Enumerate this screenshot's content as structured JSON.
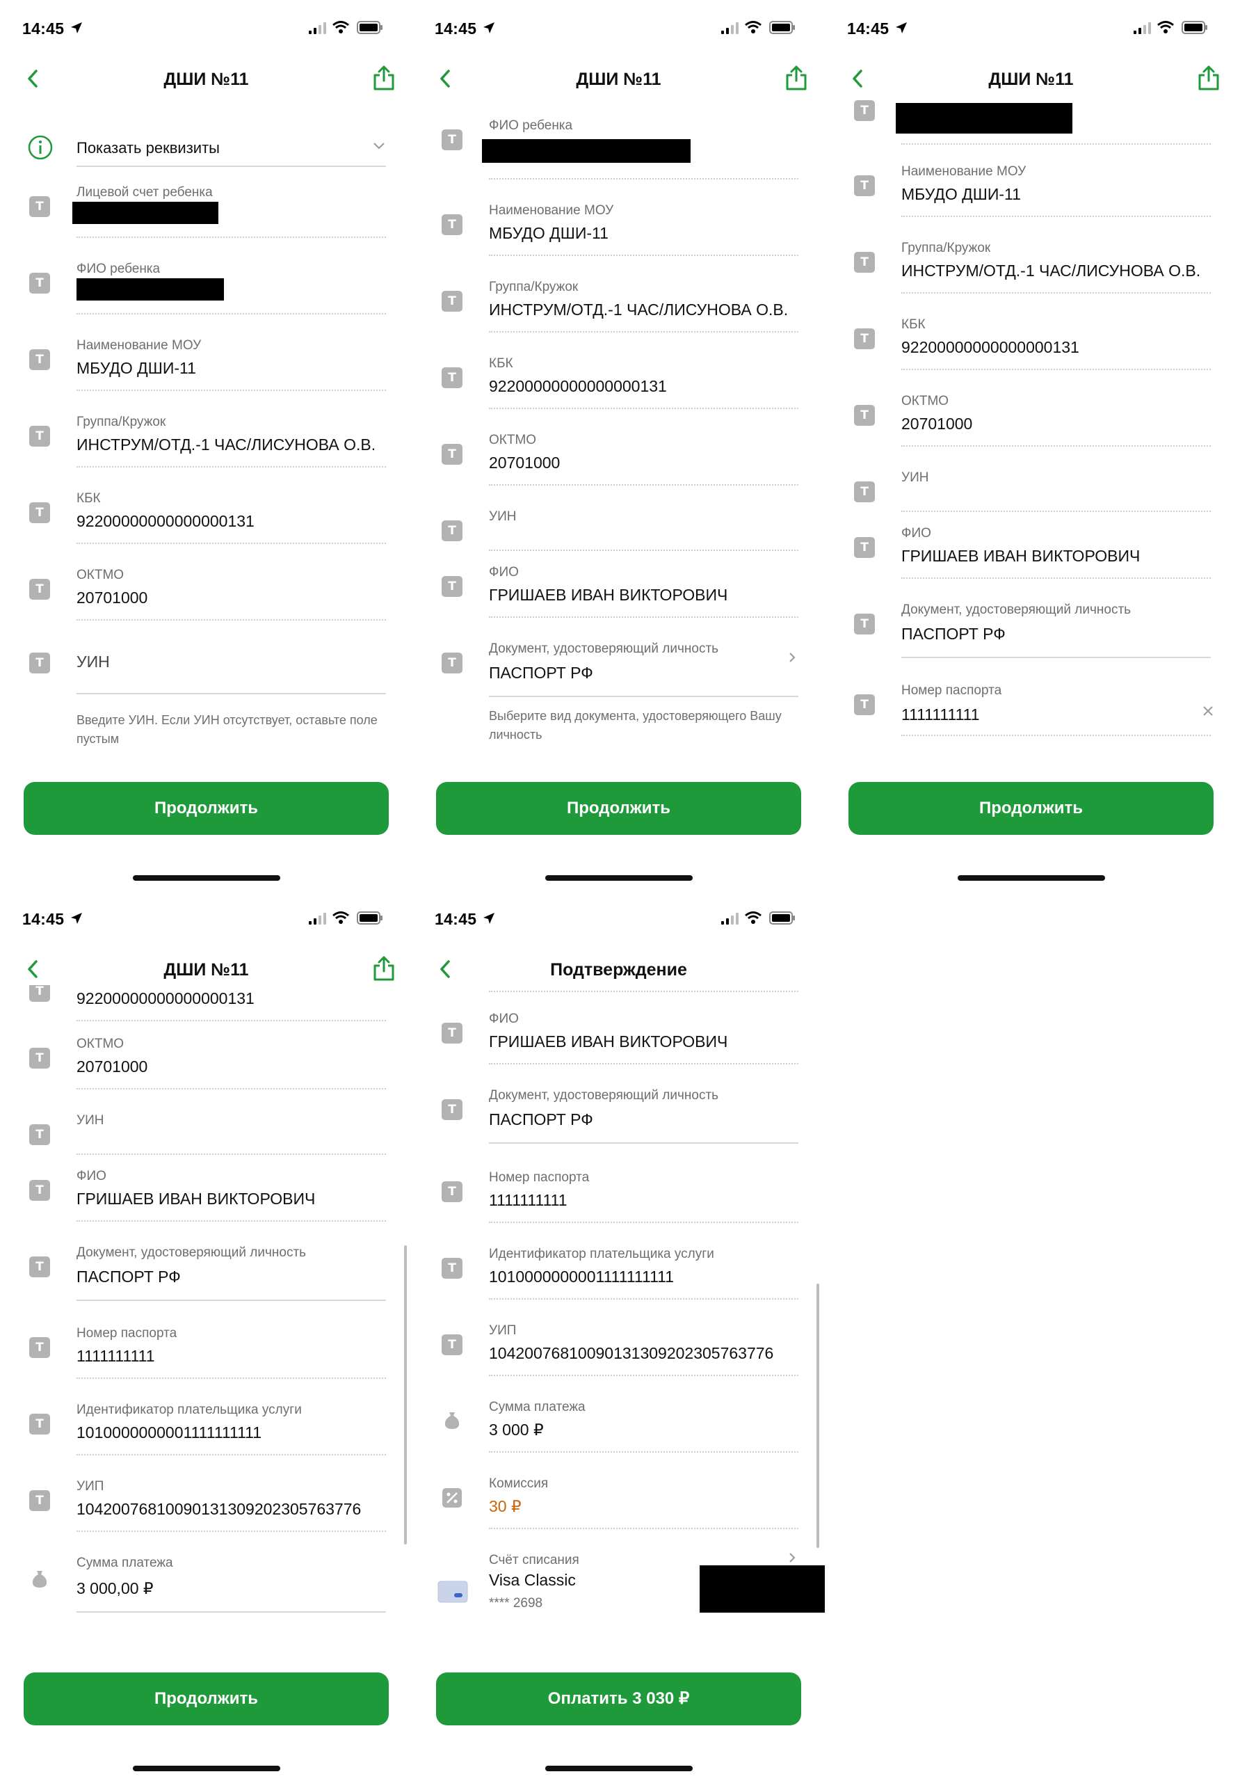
{
  "status_time": "14:45",
  "screens": [
    {
      "title": "ДШИ №11",
      "continue": "Продолжить",
      "show_details": "Показать реквизиты",
      "fields": [
        {
          "label": "Лицевой счет ребенка",
          "value": ""
        },
        {
          "label": "ФИО ребенка",
          "value": ""
        },
        {
          "label": "Наименование МОУ",
          "value": "МБУДО ДШИ-11"
        },
        {
          "label": "Группа/Кружок",
          "value": "ИНСТРУМ/ОТД.-1 ЧАС/ЛИСУНОВА О.В."
        },
        {
          "label": "КБК",
          "value": "92200000000000000131"
        },
        {
          "label": "ОКТМО",
          "value": "20701000"
        }
      ],
      "uin_placeholder": "УИН",
      "uin_hint": "Введите УИН. Если УИН отсутствует, оставьте поле пустым"
    },
    {
      "title": "ДШИ №11",
      "continue": "Продолжить",
      "fields": [
        {
          "label": "ФИО ребенка",
          "value": ""
        },
        {
          "label": "Наименование МОУ",
          "value": "МБУДО ДШИ-11"
        },
        {
          "label": "Группа/Кружок",
          "value": "ИНСТРУМ/ОТД.-1 ЧАС/ЛИСУНОВА О.В."
        },
        {
          "label": "КБК",
          "value": "92200000000000000131"
        },
        {
          "label": "ОКТМО",
          "value": "20701000"
        },
        {
          "label": "УИН",
          "value": ""
        },
        {
          "label": "ФИО",
          "value": "ГРИШАЕВ ИВАН ВИКТОРОВИЧ"
        },
        {
          "label": "Документ, удостоверяющий личность",
          "value": "ПАСПОРТ РФ"
        }
      ],
      "doc_hint": "Выберите вид документа, удостоверяющего Вашу личность"
    },
    {
      "title": "ДШИ №11",
      "continue": "Продолжить",
      "fields": [
        {
          "label": "",
          "value": ""
        },
        {
          "label": "Наименование МОУ",
          "value": "МБУДО ДШИ-11"
        },
        {
          "label": "Группа/Кружок",
          "value": "ИНСТРУМ/ОТД.-1 ЧАС/ЛИСУНОВА О.В."
        },
        {
          "label": "КБК",
          "value": "92200000000000000131"
        },
        {
          "label": "ОКТМО",
          "value": "20701000"
        },
        {
          "label": "УИН",
          "value": ""
        },
        {
          "label": "ФИО",
          "value": "ГРИШАЕВ ИВАН ВИКТОРОВИЧ"
        },
        {
          "label": "Документ, удостоверяющий личность",
          "value": "ПАСПОРТ РФ"
        },
        {
          "label": "Номер паспорта",
          "value": "1111111111"
        }
      ]
    },
    {
      "title": "ДШИ №11",
      "continue": "Продолжить",
      "fields": [
        {
          "label": "",
          "value": "92200000000000000131"
        },
        {
          "label": "ОКТМО",
          "value": "20701000"
        },
        {
          "label": "УИН",
          "value": ""
        },
        {
          "label": "ФИО",
          "value": "ГРИШАЕВ ИВАН ВИКТОРОВИЧ"
        },
        {
          "label": "Документ, удостоверяющий личность",
          "value": "ПАСПОРТ РФ"
        },
        {
          "label": "Номер паспорта",
          "value": "1111111111"
        },
        {
          "label": "Идентификатор плательщика услуги",
          "value": "1010000000001111111111"
        },
        {
          "label": "УИП",
          "value": "10420076810090131309202305763776"
        },
        {
          "label": "Сумма платежа",
          "value": "3 000,00 ₽"
        }
      ]
    },
    {
      "title": "Подтверждение",
      "pay_button": "Оплатить 3 030 ₽",
      "fields": [
        {
          "label": "ФИО",
          "value": "ГРИШАЕВ ИВАН ВИКТОРОВИЧ"
        },
        {
          "label": "Документ, удостоверяющий личность",
          "value": "ПАСПОРТ РФ"
        },
        {
          "label": "Номер паспорта",
          "value": "1111111111"
        },
        {
          "label": "Идентификатор плательщика услуги",
          "value": "1010000000001111111111"
        },
        {
          "label": "УИП",
          "value": "10420076810090131309202305763776"
        },
        {
          "label": "Сумма платежа",
          "value": "3 000 ₽"
        },
        {
          "label": "Комиссия",
          "value": "30 ₽"
        }
      ],
      "account": {
        "label": "Счёт списания",
        "card_name": "Visa Classic",
        "card_mask": "**** 2698"
      }
    }
  ],
  "colors": {
    "accent": "#1f9a3a",
    "commission": "#c8650a",
    "icon_gray": "#b2b2b2"
  },
  "icons": [
    "back-chevron-icon",
    "share-icon",
    "info-icon",
    "text-field-icon",
    "money-bag-icon",
    "percent-icon",
    "card-icon",
    "chevron-right-icon",
    "clear-icon"
  ]
}
